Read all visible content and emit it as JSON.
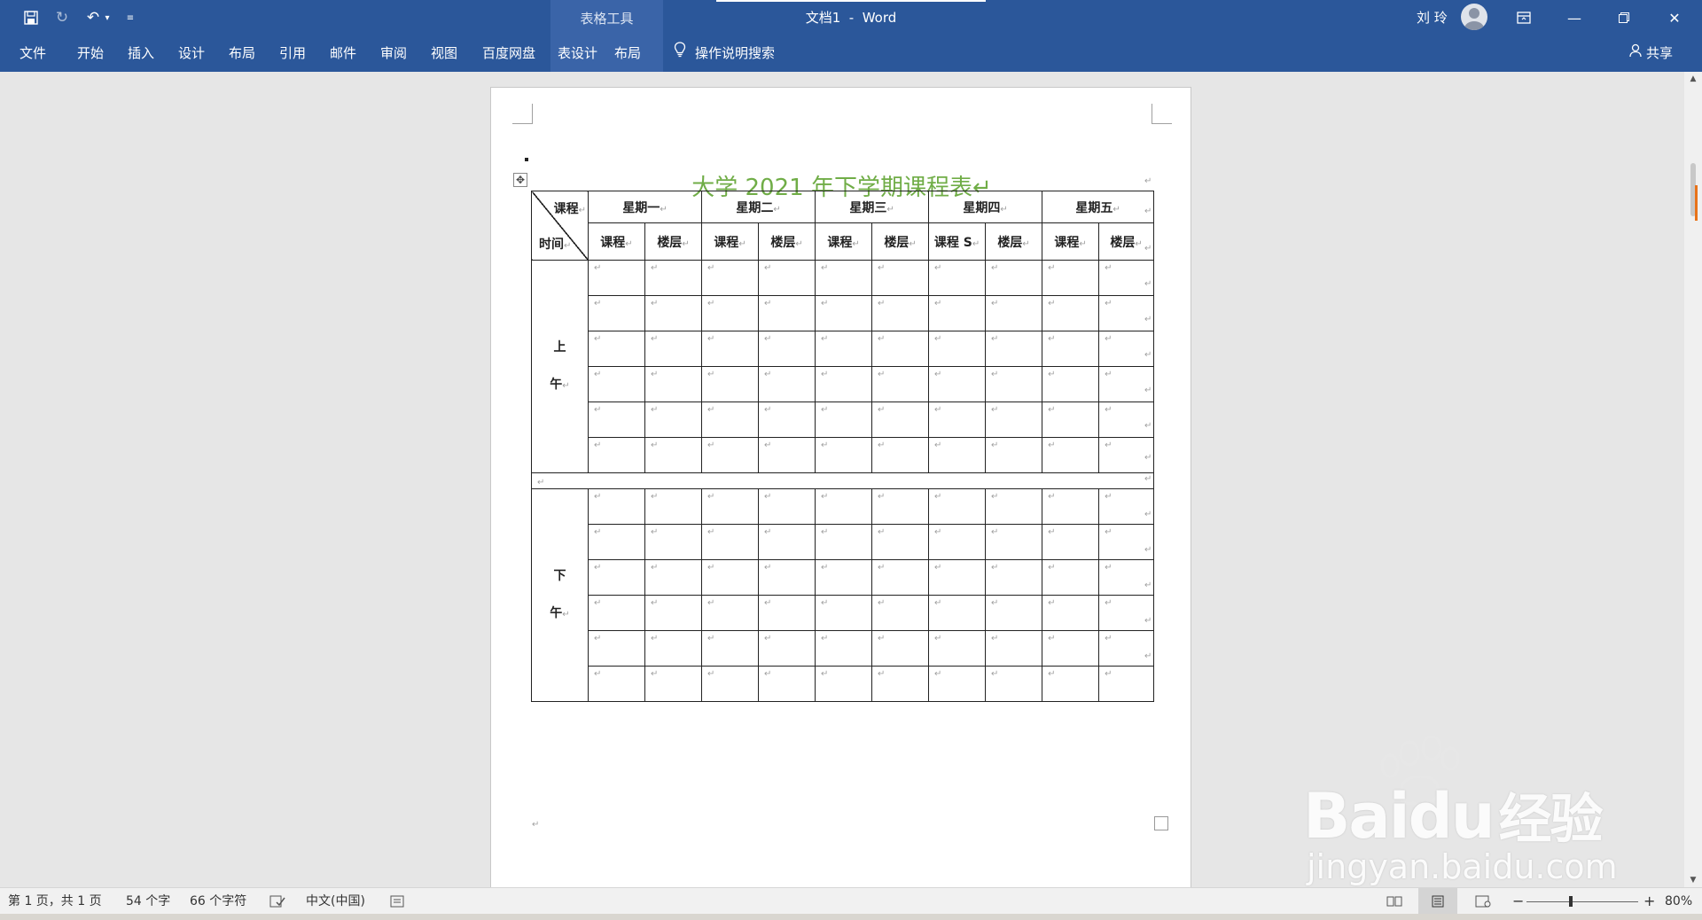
{
  "titlebar": {
    "doc_title": "文档1  -  Word",
    "context_tab": "表格工具",
    "user_name": "刘 玲"
  },
  "menu": {
    "items": [
      "文件",
      "开始",
      "插入",
      "设计",
      "布局",
      "引用",
      "邮件",
      "审阅",
      "视图",
      "百度网盘",
      "表设计",
      "布局"
    ],
    "tell_me": "操作说明搜索",
    "share": "共享"
  },
  "document": {
    "heading": "大学 2021 年下学期课程表↵",
    "table": {
      "corner_top": "课程",
      "corner_bottom": "时间",
      "days": [
        "星期一",
        "星期二",
        "星期三",
        "星期四",
        "星期五"
      ],
      "sub_headers": [
        "课程",
        "楼层",
        "课程",
        "楼层",
        "课程",
        "楼层",
        "课程 S",
        "楼层",
        "课程",
        "楼层"
      ],
      "morning": [
        "上",
        "午"
      ],
      "afternoon": [
        "下",
        "午"
      ],
      "para_mark": "↵"
    }
  },
  "status": {
    "page": "第 1 页，共 1 页",
    "words": "54 个字",
    "chars": "66 个字符",
    "language": "中文(中国)",
    "zoom": "80%"
  },
  "watermark": {
    "brand": "Baidu",
    "brand_cn": "经验",
    "url": "jingyan.baidu.com"
  },
  "colors": {
    "ribbon_blue": "#2b579a",
    "heading_green": "#70ad47",
    "scroll_marker": "#e8731a"
  }
}
